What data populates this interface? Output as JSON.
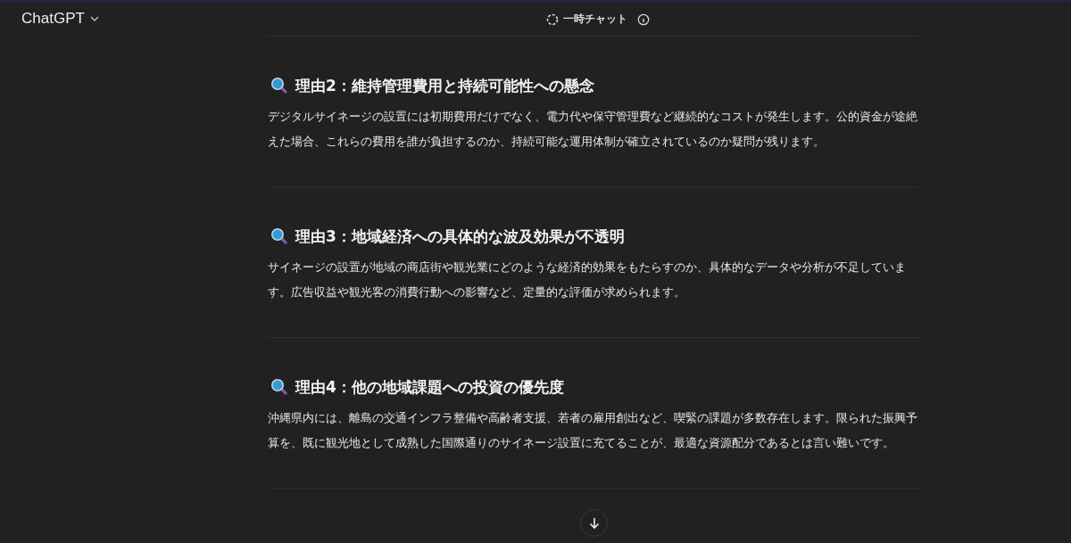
{
  "header": {
    "title": "ChatGPT",
    "chat_mode": "一時チャット"
  },
  "sections": [
    {
      "heading": "理由2：維持管理費用と持続可能性への懸念",
      "body": "デジタルサイネージの設置には初期費用だけでなく、電力代や保守管理費など継続的なコストが発生します。公的資金が途絶えた場合、これらの費用を誰が負担するのか、持続可能な運用体制が確立されているのか疑問が残ります。"
    },
    {
      "heading": "理由3：地域経済への具体的な波及効果が不透明",
      "body": "サイネージの設置が地域の商店街や観光業にどのような経済的効果をもたらすのか、具体的なデータや分析が不足しています。広告収益や観光客の消費行動への影響など、定量的な評価が求められます。"
    },
    {
      "heading": "理由4：他の地域課題への投資の優先度",
      "body": "沖縄県内には、離島の交通インフラ整備や高齢者支援、若者の雇用創出など、喫緊の課題が多数存在します。限られた振興予算を、既に観光地として成熟した国際通りのサイネージ設置に充てることが、最適な資源配分であるとは言い難いです。"
    }
  ]
}
